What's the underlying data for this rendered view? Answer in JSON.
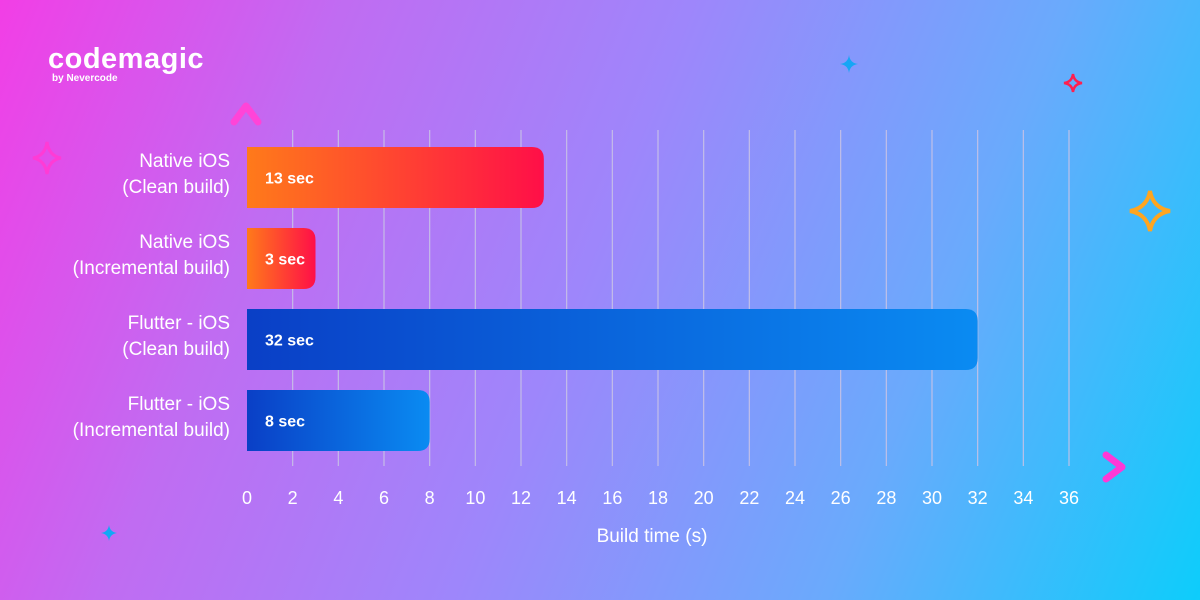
{
  "brand": {
    "name": "codemagic",
    "tagline": "by Nevercode"
  },
  "colors": {
    "native_gradient": [
      "#ff7a1a",
      "#ff0f48"
    ],
    "flutter_gradient": [
      "#0a3fc6",
      "#0a8bf2"
    ],
    "axis_gradient": [
      "#ffa21c",
      "#ff38d6"
    ],
    "grid": "#c9c3e6"
  },
  "chart_data": {
    "type": "bar",
    "orientation": "horizontal",
    "categories": [
      [
        "Native iOS",
        "(Clean build)"
      ],
      [
        "Native iOS",
        "(Incremental build)"
      ],
      [
        "Flutter - iOS",
        "(Clean build)"
      ],
      [
        "Flutter - iOS",
        "(Incremental build)"
      ]
    ],
    "values": [
      13,
      3,
      32,
      8
    ],
    "data_labels": [
      "13 sec",
      "3 sec",
      "32 sec",
      "8 sec"
    ],
    "bar_groups": [
      "native",
      "native",
      "flutter",
      "flutter"
    ],
    "xlabel": "Build time (s)",
    "xlim": [
      0,
      36
    ],
    "xticks": [
      0,
      2,
      4,
      6,
      8,
      10,
      12,
      14,
      16,
      18,
      20,
      22,
      24,
      26,
      28,
      30,
      32,
      34,
      36
    ],
    "grid": true
  }
}
